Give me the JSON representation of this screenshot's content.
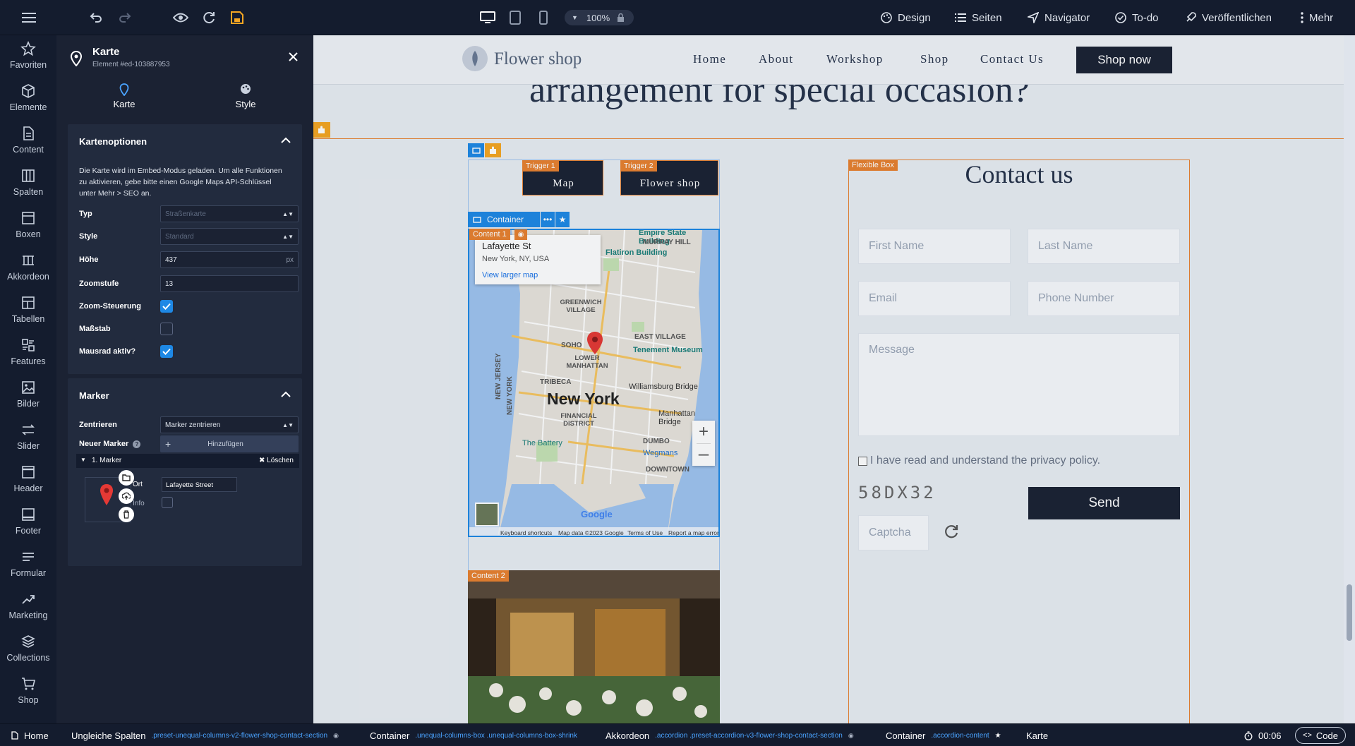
{
  "topbar": {
    "zoom": "100%",
    "menu": [
      {
        "label": "Design",
        "icon": "palette-icon"
      },
      {
        "label": "Seiten",
        "icon": "list-icon"
      },
      {
        "label": "Navigator",
        "icon": "navigator-icon"
      },
      {
        "label": "To-do",
        "icon": "check-circle-icon"
      },
      {
        "label": "Veröffentlichen",
        "icon": "rocket-icon"
      },
      {
        "label": "Mehr",
        "icon": "more-vertical-icon"
      }
    ]
  },
  "rail": [
    {
      "label": "Favoriten",
      "icon": "star-icon"
    },
    {
      "label": "Elemente",
      "icon": "cube-icon"
    },
    {
      "label": "Content",
      "icon": "document-icon"
    },
    {
      "label": "Spalten",
      "icon": "columns-icon"
    },
    {
      "label": "Boxen",
      "icon": "box-icon"
    },
    {
      "label": "Akkordeon",
      "icon": "accordion-icon"
    },
    {
      "label": "Tabellen",
      "icon": "table-icon"
    },
    {
      "label": "Features",
      "icon": "features-icon"
    },
    {
      "label": "Bilder",
      "icon": "image-icon"
    },
    {
      "label": "Slider",
      "icon": "slider-icon"
    },
    {
      "label": "Header",
      "icon": "header-icon"
    },
    {
      "label": "Footer",
      "icon": "footer-icon"
    },
    {
      "label": "Formular",
      "icon": "form-icon"
    },
    {
      "label": "Marketing",
      "icon": "chart-line-icon"
    },
    {
      "label": "Collections",
      "icon": "layers-icon"
    },
    {
      "label": "Shop",
      "icon": "cart-icon"
    }
  ],
  "panel": {
    "title": "Karte",
    "subtitle": "Element #ed-103887953",
    "tabs": [
      "Karte",
      "Style"
    ],
    "options": {
      "title": "Kartenoptionen",
      "info": "Die Karte wird im Embed-Modus geladen. Um alle Funktionen zu aktivieren, gebe bitte einen Google Maps API-Schlüssel unter Mehr > SEO an.",
      "typ_label": "Typ",
      "typ_value": "Straßenkarte",
      "style_label": "Style",
      "style_value": "Standard",
      "hoehe_label": "Höhe",
      "hoehe_value": "437",
      "hoehe_unit": "px",
      "zoom_label": "Zoomstufe",
      "zoom_value": "13",
      "zoomctrl_label": "Zoom-Steuerung",
      "zoomctrl_checked": true,
      "scale_label": "Maßstab",
      "scale_checked": false,
      "wheel_label": "Mausrad aktiv?",
      "wheel_checked": true
    },
    "marker": {
      "title": "Marker",
      "center_label": "Zentrieren",
      "center_value": "Marker zentrieren",
      "new_label": "Neuer Marker",
      "add_button": "Hinzufügen",
      "item_label": "1. Marker",
      "delete_label": "Löschen",
      "ort_label": "Ort",
      "ort_value": "Lafayette Street",
      "info_label": "Info",
      "info_checked": false
    }
  },
  "site": {
    "brand": "Flower shop",
    "nav": [
      "Home",
      "About",
      "Workshop",
      "Shop",
      "Contact Us"
    ],
    "cta": "Shop now",
    "heading_fragment": "arrangement for special occasion?",
    "contact_title": "Contact us",
    "form": {
      "first_name": "First Name",
      "last_name": "Last Name",
      "email": "Email",
      "phone": "Phone Number",
      "message": "Message",
      "privacy": "I have read and understand the privacy policy.",
      "captcha_code": "58DX32",
      "captcha_placeholder": "Captcha",
      "send": "Send"
    },
    "tabs": [
      {
        "tag": "Trigger 1",
        "label": "Map"
      },
      {
        "tag": "Trigger 2",
        "label": "Flower shop"
      }
    ],
    "tags": {
      "flexible_box": "Flexible Box",
      "content1": "Content 1",
      "content2": "Content 2",
      "container": "Container"
    },
    "map": {
      "place": "Lafayette St",
      "address": "New York, NY, USA",
      "larger": "View larger map",
      "footer": [
        "Keyboard shortcuts",
        "Map data ©2023 Google",
        "Terms of Use",
        "Report a map error"
      ],
      "labels": [
        "Empire State Building",
        "MURRAY HILL",
        "Flatiron Building",
        "GREENWICH VILLAGE",
        "EAST VILLAGE",
        "SOHO",
        "LOWER MANHATTAN",
        "Tenement Museum",
        "TRIBECA",
        "New York",
        "Williamsburg Bridge",
        "FINANCIAL DISTRICT",
        "Manhattan Bridge",
        "The Battery",
        "DUMBO",
        "Wegmans",
        "DOWNTOWN",
        "NEW JERSEY",
        "NEW YORK"
      ]
    }
  },
  "bottombar": {
    "crumbs": [
      {
        "label": "Home",
        "cls": ""
      },
      {
        "label": "Ungleiche Spalten",
        "cls": ".preset-unequal-columns-v2-flower-shop-contact-section"
      },
      {
        "label": "Container",
        "cls": ".unequal-columns-box .unequal-columns-box-shrink"
      },
      {
        "label": "Akkordeon",
        "cls": ".accordion .preset-accordion-v3-flower-shop-contact-section"
      },
      {
        "label": "Container",
        "cls": ".accordion-content"
      },
      {
        "label": "Karte",
        "cls": ""
      }
    ],
    "timer": "00:06",
    "code": "Code"
  }
}
